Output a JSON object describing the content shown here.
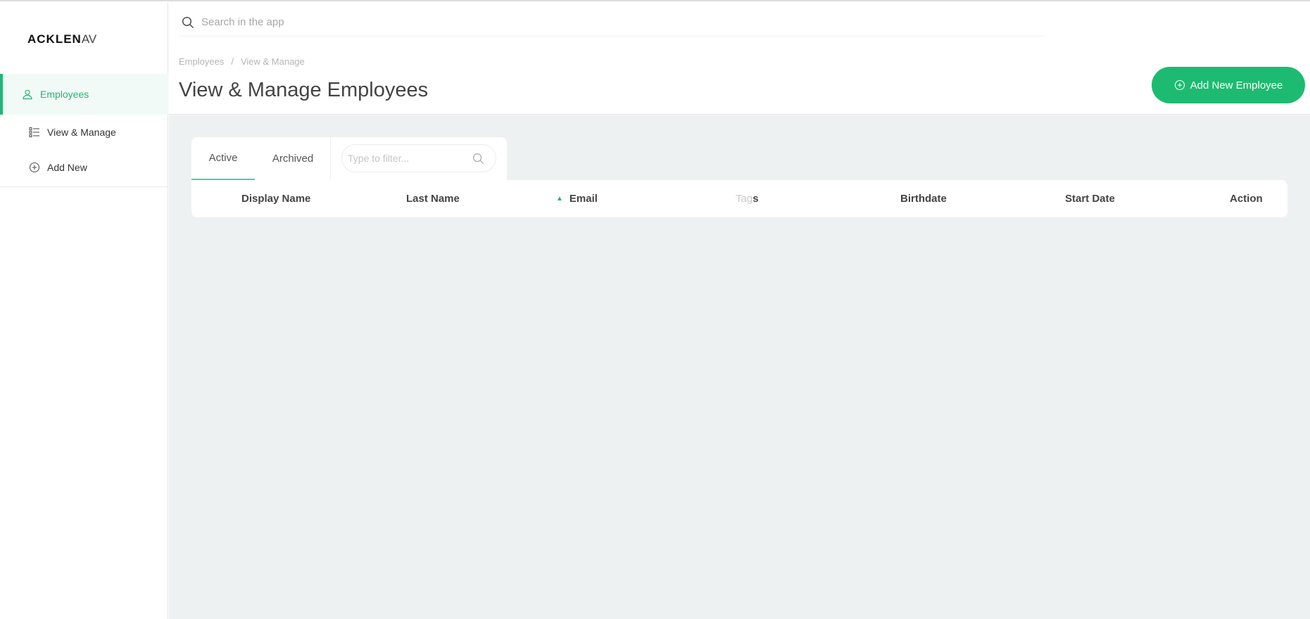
{
  "app": {
    "logo_main": "ACKLEN",
    "logo_tail": "AV"
  },
  "sidebar": {
    "section_label": "Employees",
    "items": [
      {
        "label": "View & Manage",
        "icon": "list-icon"
      },
      {
        "label": "Add New",
        "icon": "plus-circle-icon"
      }
    ]
  },
  "search": {
    "placeholder": "Search in the app"
  },
  "breadcrumb": {
    "root": "Employees",
    "sep": "/",
    "current": "View & Manage"
  },
  "page": {
    "title": "View & Manage Employees"
  },
  "actions": {
    "add_label": "Add New Employee"
  },
  "tabs": [
    {
      "label": "Active"
    },
    {
      "label": "Archived"
    }
  ],
  "filter": {
    "placeholder": "Type to filter..."
  },
  "table": {
    "columns": [
      {
        "label": "Display Name"
      },
      {
        "label": "Last Name"
      },
      {
        "label": "Email",
        "sort": "asc"
      },
      {
        "label_faded": "Tag",
        "label": "s"
      },
      {
        "label": "Birthdate"
      },
      {
        "label": "Start Date"
      },
      {
        "label": "Action"
      }
    ],
    "sort_indicator": "▲"
  },
  "colors": {
    "accent": "#1dbb71",
    "active_tab_underline": "#4ccfa1",
    "content_bg": "#edf1f1"
  }
}
